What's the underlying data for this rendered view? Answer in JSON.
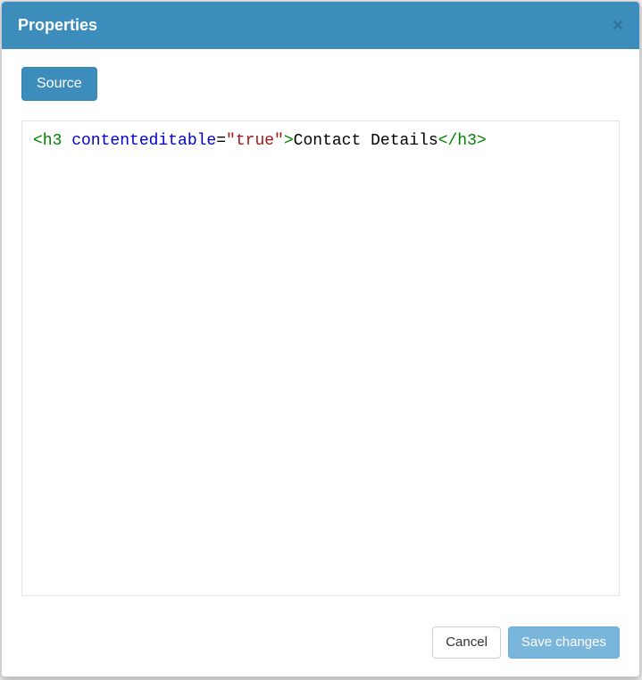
{
  "header": {
    "title": "Properties"
  },
  "toolbar": {
    "source_label": "Source"
  },
  "editor": {
    "open_tag": "<h3",
    "attr_name": " contenteditable",
    "attr_eq": "=",
    "attr_str": "\"true\"",
    "open_tag_close": ">",
    "text": "Contact Details",
    "close_tag": "</h3>"
  },
  "footer": {
    "cancel_label": "Cancel",
    "save_label": "Save changes"
  }
}
